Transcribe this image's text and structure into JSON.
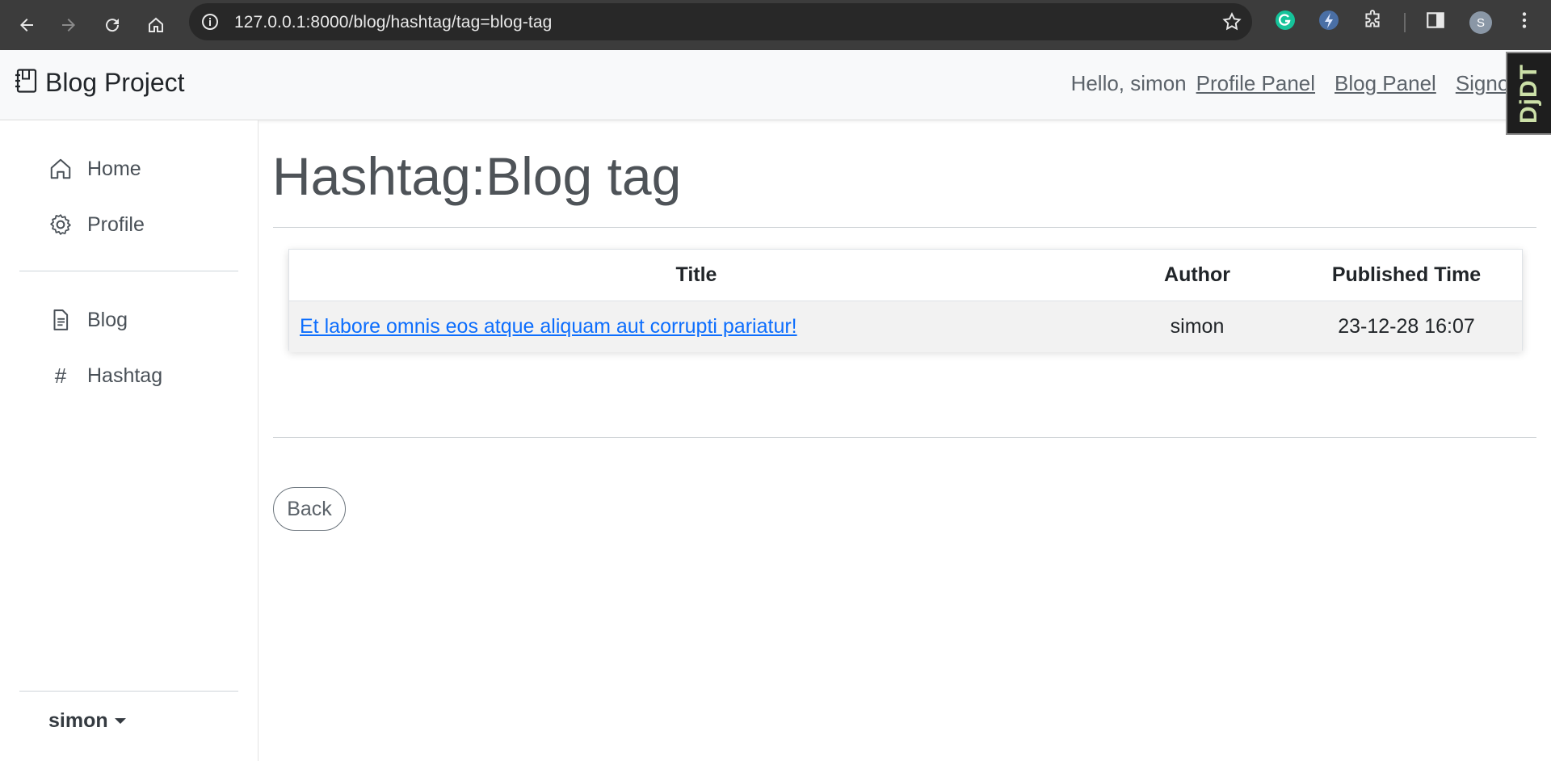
{
  "browser": {
    "url": "127.0.0.1:8000/blog/hashtag/tag=blog-tag",
    "profile_initial": "S"
  },
  "navbar": {
    "brand": "Blog Project",
    "greeting": "Hello, simon",
    "links": [
      "Profile Panel",
      "Blog Panel",
      "Signout"
    ],
    "debug_toolbar_label": "DjDT"
  },
  "sidebar": {
    "items": [
      {
        "label": "Home",
        "icon": "home-icon"
      },
      {
        "label": "Profile",
        "icon": "gear-icon"
      },
      {
        "label": "Blog",
        "icon": "document-icon"
      },
      {
        "label": "Hashtag",
        "icon": "hash-icon"
      }
    ],
    "user": "simon"
  },
  "main": {
    "title": "Hashtag:Blog tag",
    "table": {
      "headers": [
        "Title",
        "Author",
        "Published Time"
      ],
      "rows": [
        {
          "title": "Et labore omnis eos atque aliquam aut corrupti pariatur!",
          "author": "simon",
          "published": "23-12-28 16:07"
        }
      ]
    },
    "back_label": "Back"
  }
}
